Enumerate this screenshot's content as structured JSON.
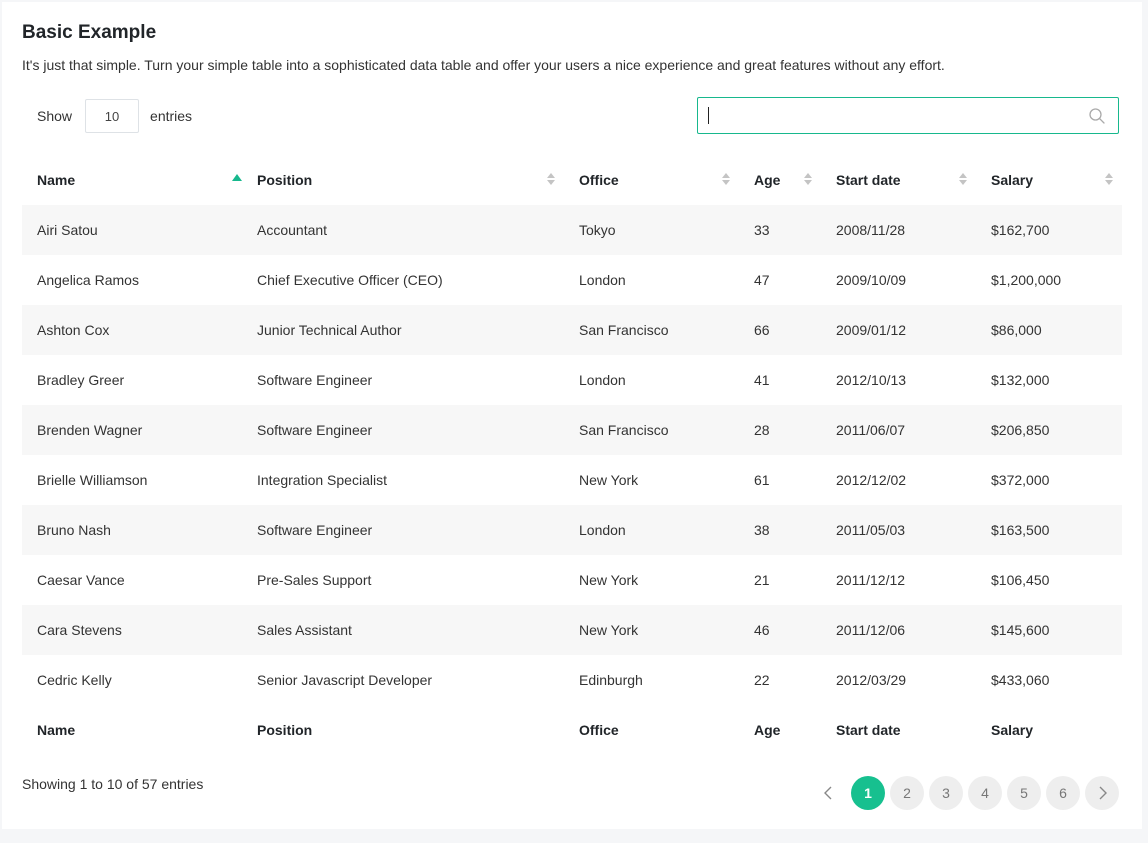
{
  "header": {
    "title": "Basic Example",
    "description": "It's just that simple. Turn your simple table into a sophisticated data table and offer your users a nice experience and great features without any effort."
  },
  "length": {
    "show_label": "Show",
    "value": "10",
    "entries_label": "entries"
  },
  "search": {
    "value": ""
  },
  "table": {
    "columns": [
      "Name",
      "Position",
      "Office",
      "Age",
      "Start date",
      "Salary"
    ],
    "sorted_column": "Name",
    "sort_direction": "ascending",
    "rows": [
      [
        "Airi Satou",
        "Accountant",
        "Tokyo",
        "33",
        "2008/11/28",
        "$162,700"
      ],
      [
        "Angelica Ramos",
        "Chief Executive Officer (CEO)",
        "London",
        "47",
        "2009/10/09",
        "$1,200,000"
      ],
      [
        "Ashton Cox",
        "Junior Technical Author",
        "San Francisco",
        "66",
        "2009/01/12",
        "$86,000"
      ],
      [
        "Bradley Greer",
        "Software Engineer",
        "London",
        "41",
        "2012/10/13",
        "$132,000"
      ],
      [
        "Brenden Wagner",
        "Software Engineer",
        "San Francisco",
        "28",
        "2011/06/07",
        "$206,850"
      ],
      [
        "Brielle Williamson",
        "Integration Specialist",
        "New York",
        "61",
        "2012/12/02",
        "$372,000"
      ],
      [
        "Bruno Nash",
        "Software Engineer",
        "London",
        "38",
        "2011/05/03",
        "$163,500"
      ],
      [
        "Caesar Vance",
        "Pre-Sales Support",
        "New York",
        "21",
        "2011/12/12",
        "$106,450"
      ],
      [
        "Cara Stevens",
        "Sales Assistant",
        "New York",
        "46",
        "2011/12/06",
        "$145,600"
      ],
      [
        "Cedric Kelly",
        "Senior Javascript Developer",
        "Edinburgh",
        "22",
        "2012/03/29",
        "$433,060"
      ]
    ]
  },
  "footer": {
    "info": "Showing 1 to 10 of 57 entries",
    "pages": [
      "1",
      "2",
      "3",
      "4",
      "5",
      "6"
    ],
    "current_page": "1"
  },
  "colors": {
    "accent": "#17c08f",
    "stripe": "#f7f7f7",
    "pager_bg": "#eeeeee"
  },
  "icons": {
    "search": "search-icon",
    "prev": "chevron-left-icon",
    "next": "chevron-right-icon"
  }
}
